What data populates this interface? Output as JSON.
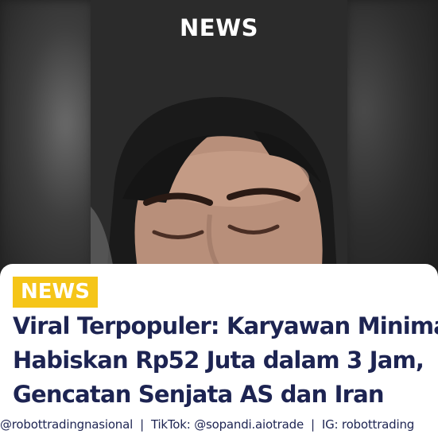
{
  "video": {
    "overlay_title": "NEWS"
  },
  "card": {
    "tag": "NEWS",
    "headline_lines": [
      "Viral Terpopuler: Karyawan Minimal",
      "Habiskan Rp52 Juta dalam 3 Jam,",
      "Gencatan Senjata AS dan Iran"
    ],
    "footer": {
      "instagram_left": "@robottradingnasional",
      "separator": "|",
      "tiktok": "TikTok: @sopandi.aiotrade",
      "instagram_right": "IG: robottrading"
    }
  },
  "colors": {
    "tag_bg": "#f5c518",
    "headline": "#1d2452",
    "card_bg": "#ffffff"
  }
}
